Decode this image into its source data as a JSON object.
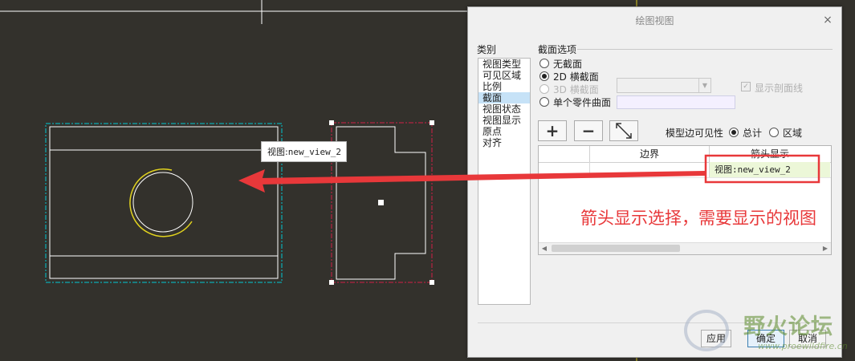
{
  "dialog": {
    "title": "绘图视图",
    "close_glyph": "×",
    "category_label": "类别",
    "categories": [
      {
        "label": "视图类型",
        "selected": false
      },
      {
        "label": "可见区域",
        "selected": false
      },
      {
        "label": "比例",
        "selected": false
      },
      {
        "label": "截面",
        "selected": true
      },
      {
        "label": "视图状态",
        "selected": false
      },
      {
        "label": "视图显示",
        "selected": false
      },
      {
        "label": "原点",
        "selected": false
      },
      {
        "label": "对齐",
        "selected": false
      }
    ],
    "section_options_title": "截面选项",
    "radio_no_section": "无截面",
    "radio_2d_section": "2D 横截面",
    "radio_3d_section": "3D 横截面",
    "radio_single_surface": "单个零件曲面",
    "selected_option": "2D 横截面",
    "show_hatch_label": "显示剖面线",
    "show_hatch_checked": true,
    "model_edge_visibility_label": "模型边可见性",
    "vis_total_label": "总计",
    "vis_area_label": "区域",
    "vis_selected": "总计",
    "table": {
      "headers": [
        "",
        "边界",
        "箭头显示"
      ],
      "rows": [
        {
          "name": "",
          "boundary": "",
          "arrow_display": "视图:new_view_2"
        }
      ]
    },
    "apply_label": "应用",
    "ok_label": "确定",
    "cancel_label": "取消"
  },
  "tooltip": {
    "prefix": "视图:",
    "view_name": "new_view_2"
  },
  "annotation_text": "箭头显示选择，需要显示的视图",
  "watermark": {
    "title": "野火论坛",
    "url": "www.proewildfire.cn"
  },
  "colors": {
    "canvas_bg": "#33312c",
    "annotation_red": "#e8383a",
    "view_border_cyan": "#00c8d2",
    "view_border_red": "#d21e46",
    "highlight_circle": "#e1d21e",
    "cell_highlight": "#ecf7d8"
  },
  "icons": {
    "add": "plus-icon",
    "remove": "minus-icon",
    "flip": "flip-arrow-icon"
  }
}
